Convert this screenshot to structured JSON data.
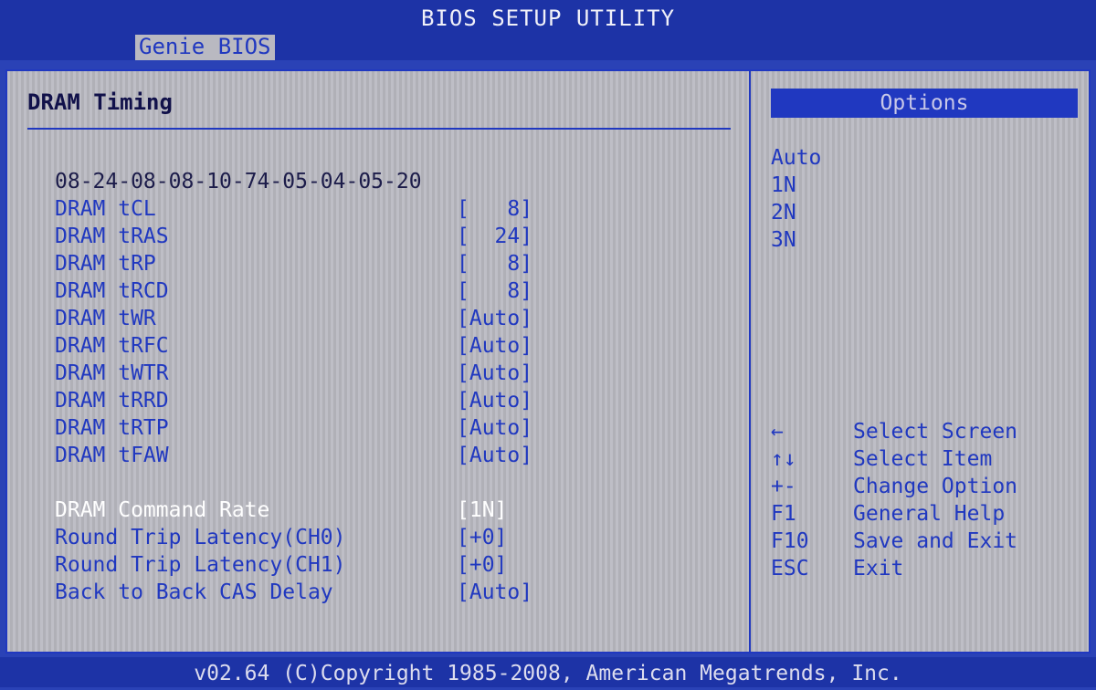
{
  "title": "BIOS SETUP UTILITY",
  "menu": {
    "active_tab": "Genie BIOS"
  },
  "main": {
    "section_title": "DRAM Timing",
    "timing_summary": "08-24-08-08-10-74-05-04-05-20",
    "settings": [
      {
        "label": "DRAM tCL",
        "value": "[   8]"
      },
      {
        "label": "DRAM tRAS",
        "value": "[  24]"
      },
      {
        "label": "DRAM tRP",
        "value": "[   8]"
      },
      {
        "label": "DRAM tRCD",
        "value": "[   8]"
      },
      {
        "label": "DRAM tWR",
        "value": "[Auto]"
      },
      {
        "label": "DRAM tRFC",
        "value": "[Auto]"
      },
      {
        "label": "DRAM tWTR",
        "value": "[Auto]"
      },
      {
        "label": "DRAM tRRD",
        "value": "[Auto]"
      },
      {
        "label": "DRAM tRTP",
        "value": "[Auto]"
      },
      {
        "label": "DRAM tFAW",
        "value": "[Auto]"
      },
      {
        "label": "DRAM Command Rate",
        "value": "[1N]",
        "selected": true
      },
      {
        "label": "Round Trip Latency(CH0)",
        "value": "[+0]"
      },
      {
        "label": "Round Trip Latency(CH1)",
        "value": "[+0]"
      },
      {
        "label": "Back to Back CAS Delay",
        "value": "[Auto]"
      }
    ]
  },
  "options": {
    "header": "Options",
    "items": [
      "Auto",
      "1N",
      "2N",
      "3N"
    ]
  },
  "help": [
    {
      "key": "←",
      "desc": "Select Screen"
    },
    {
      "key": "↑↓",
      "desc": "Select Item"
    },
    {
      "key": "+-",
      "desc": "Change Option"
    },
    {
      "key": "F1",
      "desc": "General Help"
    },
    {
      "key": "F10",
      "desc": "Save and Exit"
    },
    {
      "key": "ESC",
      "desc": "Exit"
    }
  ],
  "footer": "v02.64 (C)Copyright 1985-2008, American Megatrends, Inc.",
  "colors": {
    "background": "#b9b9c1",
    "accent": "#2038c0",
    "selected_text": "#ffffff"
  }
}
